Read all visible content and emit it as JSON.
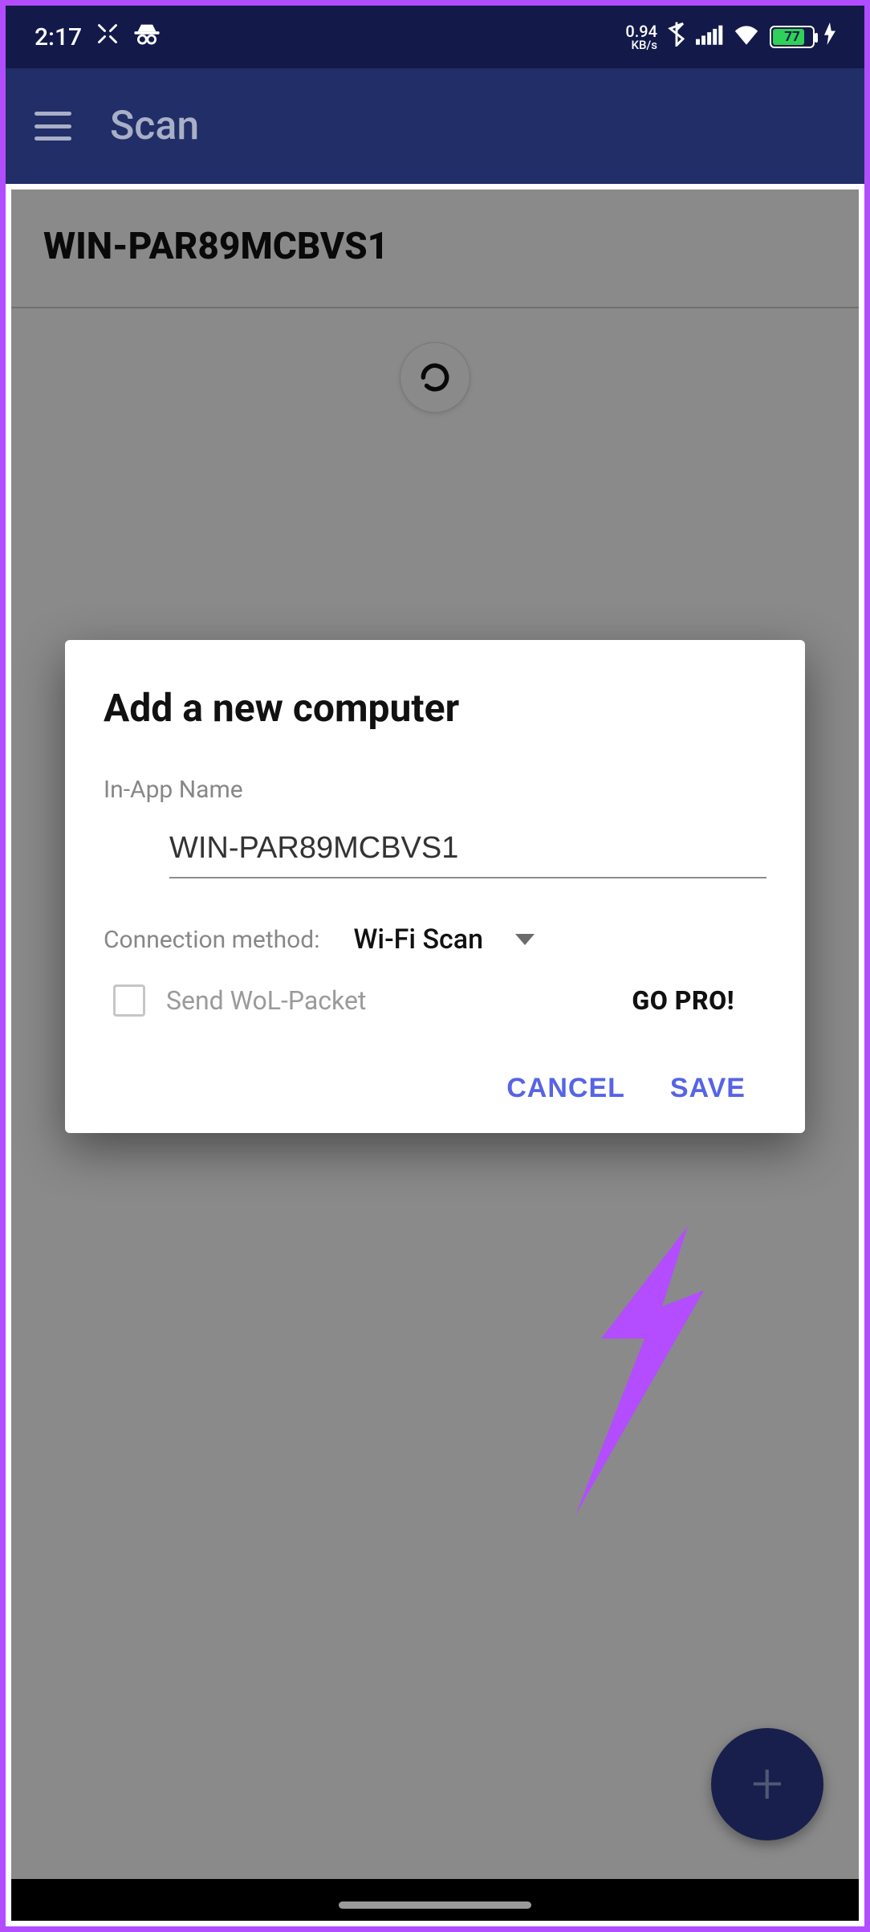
{
  "status_bar": {
    "time": "2:17",
    "net_rate_value": "0.94",
    "net_rate_unit": "KB/s",
    "battery_pct": "77"
  },
  "app_bar": {
    "title": "Scan"
  },
  "background": {
    "device_name": "WIN-PAR89MCBVS1"
  },
  "dialog": {
    "title": "Add a new computer",
    "name_label": "In-App Name",
    "name_value": "WIN-PAR89MCBVS1",
    "connection_label": "Connection method:",
    "connection_value": "Wi-Fi Scan",
    "wol_label": "Send WoL-Packet",
    "gopro_label": "GO PRO!",
    "cancel_label": "CANCEL",
    "save_label": "SAVE"
  },
  "fab": {
    "glyph": "+"
  }
}
